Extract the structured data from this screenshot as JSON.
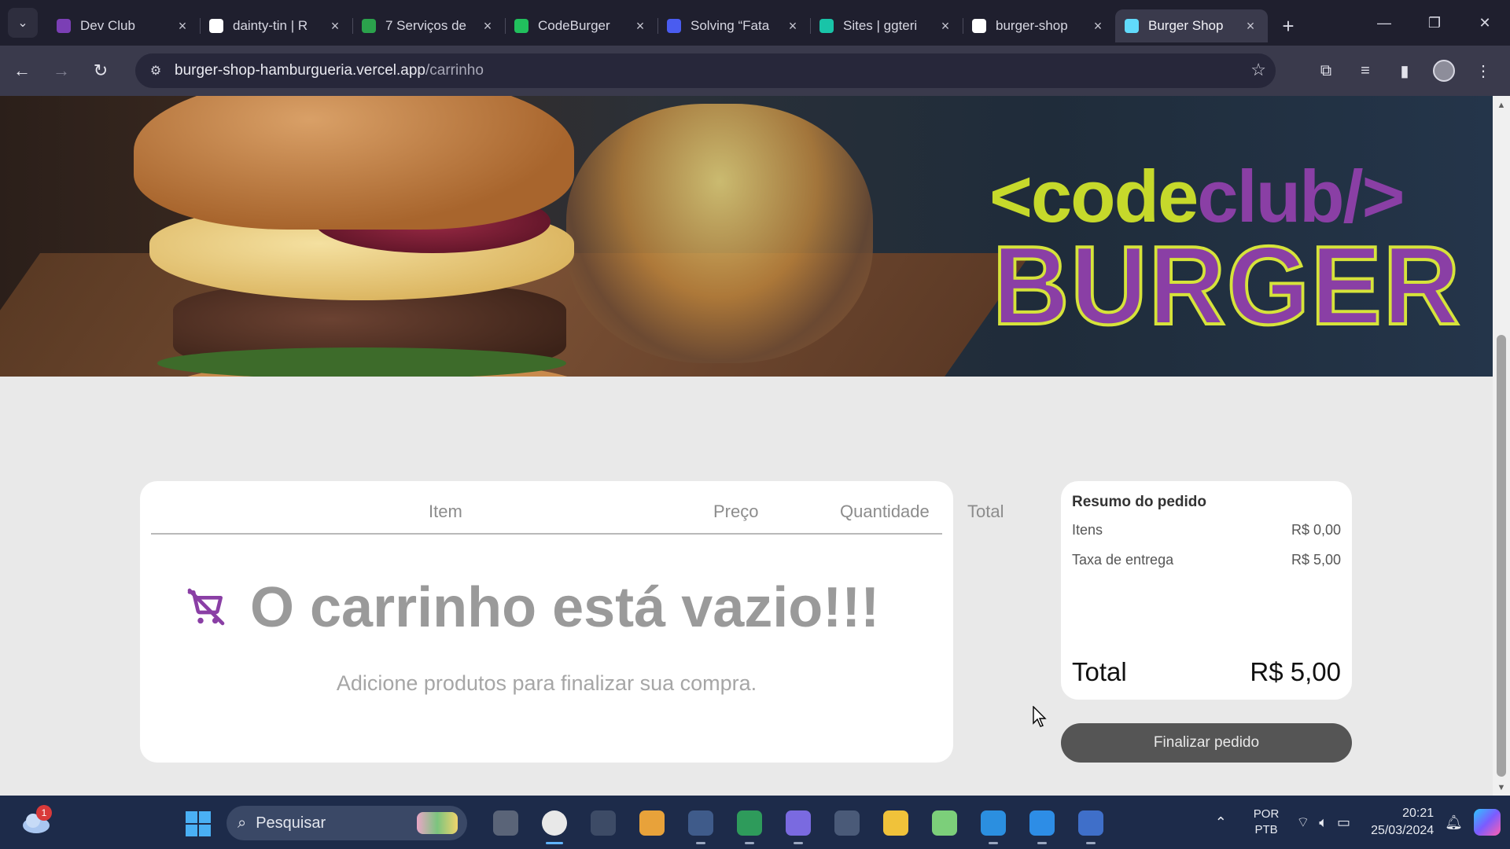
{
  "browser": {
    "tabs": [
      {
        "title": "Dev Club",
        "favicon": "devclub-icon",
        "color": "#7b3fb5"
      },
      {
        "title": "dainty-tin | R",
        "favicon": "github-icon",
        "color": "#ffffff"
      },
      {
        "title": "7 Serviços de",
        "favicon": "code-icon",
        "color": "#2ba24c"
      },
      {
        "title": "CodeBurger",
        "favicon": "lightning-icon",
        "color": "#21c05d"
      },
      {
        "title": "Solving “Fata",
        "favicon": "vercel-doc-icon",
        "color": "#4a5cf0"
      },
      {
        "title": "Sites | ggteri",
        "favicon": "diamond-icon",
        "color": "#19c4a8"
      },
      {
        "title": "burger-shop",
        "favicon": "vercel-icon",
        "color": "#ffffff"
      },
      {
        "title": "Burger Shop",
        "favicon": "react-icon",
        "color": "#61dafb"
      }
    ],
    "active_tab": 7,
    "url_host": "burger-shop-hamburgueria.vercel.app",
    "url_path": "/carrinho"
  },
  "hero": {
    "logo_line1_a": "<code",
    "logo_line1_b": "club/>",
    "logo_line2": "BURGER",
    "colors": {
      "lime": "#c6d92b",
      "purple": "#8a3fa5"
    }
  },
  "cart": {
    "headers": [
      "Item",
      "Preço",
      "Quantidade",
      "Total"
    ],
    "empty_title": "O carrinho está vazio!!!",
    "empty_subtitle": "Adicione produtos para finalizar sua compra.",
    "icon": "cart-off-icon",
    "icon_color": "#8a3fa5"
  },
  "summary": {
    "title": "Resumo do pedido",
    "rows": [
      {
        "label": "Itens",
        "value": "R$ 0,00"
      },
      {
        "label": "Taxa de entrega",
        "value": "R$ 5,00"
      }
    ],
    "total_label": "Total",
    "total_value": "R$ 5,00",
    "button_label": "Finalizar pedido"
  },
  "taskbar": {
    "weather_badge": "1",
    "search_placeholder": "Pesquisar",
    "apps": [
      "task-view",
      "chrome",
      "camera",
      "microsoft-store",
      "app",
      "app",
      "app",
      "calculator",
      "file-explorer",
      "paint",
      "vscode",
      "docker",
      "screen-recorder"
    ],
    "lang_line1": "POR",
    "lang_line2": "PTB",
    "time": "20:21",
    "date": "25/03/2024"
  }
}
